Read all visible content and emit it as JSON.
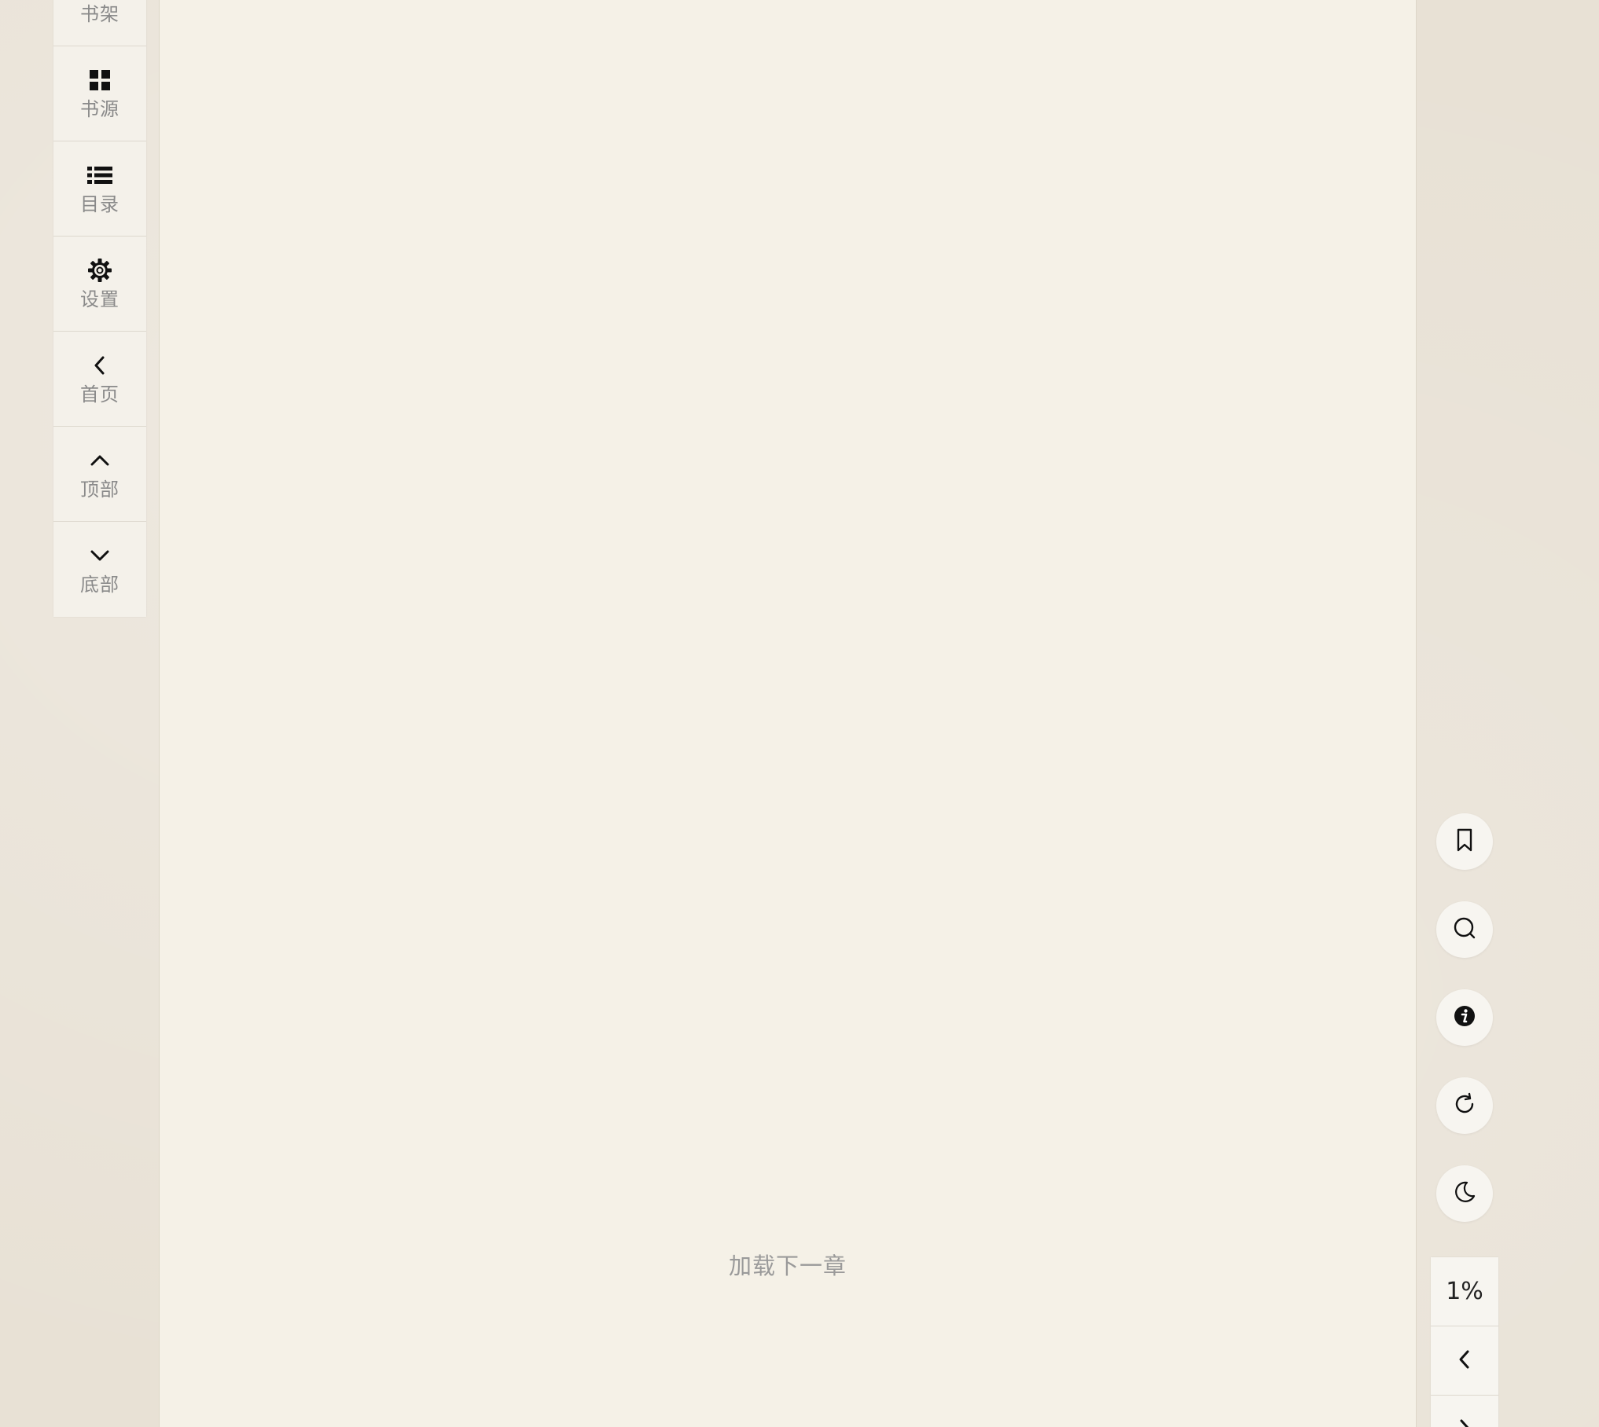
{
  "sidebar": {
    "items": [
      {
        "label": "书架",
        "icon": "bookshelf-icon"
      },
      {
        "label": "书源",
        "icon": "grid-icon"
      },
      {
        "label": "目录",
        "icon": "list-icon"
      },
      {
        "label": "设置",
        "icon": "gear-icon"
      },
      {
        "label": "首页",
        "icon": "chevron-left-icon"
      },
      {
        "label": "顶部",
        "icon": "chevron-up-icon"
      },
      {
        "label": "底部",
        "icon": "chevron-down-icon"
      }
    ]
  },
  "content": {
    "load_next_label": "加载下一章"
  },
  "right_tools": {
    "buttons": [
      "bookmark-icon",
      "search-icon",
      "info-icon",
      "refresh-icon",
      "moon-icon"
    ],
    "progress": "1%",
    "nav": [
      "chevron-left-icon",
      "chevron-right-icon"
    ]
  },
  "colors": {
    "background": "#e8e1d5",
    "paper": "#f5f1e7",
    "panel": "#f4f1ea",
    "label_gray": "#8a8a8a"
  }
}
